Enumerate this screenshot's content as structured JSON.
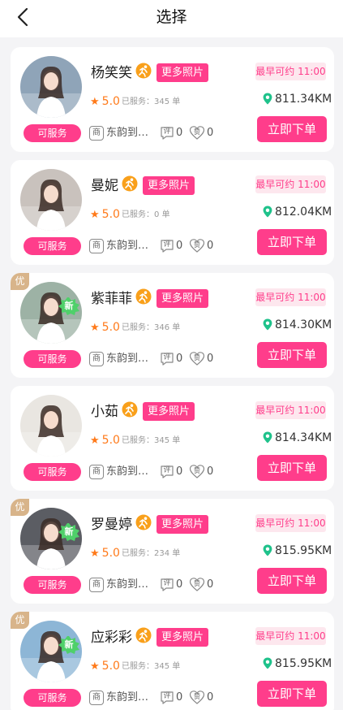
{
  "header": {
    "title": "选择"
  },
  "card_labels": {
    "more_photos": "更多照片",
    "served_prefix": "已服务：",
    "served_suffix": "单",
    "order_button": "立即下单",
    "shop_icon_char": "商",
    "review_icon_char": "评",
    "like_icon_char": "赞",
    "premium_tag": "优",
    "new_badge": "新"
  },
  "colors": {
    "accent": "#ff3d8b",
    "earliest_bg": "#fde7ee",
    "rating": "#ff7a1a",
    "badge_orange": "#f9a01b",
    "premium_tag_bg": "#d8b48a",
    "new_badge_green": "#4fd06a",
    "distance_pin": "#1fc28b",
    "page_bg": "#f4f4f6"
  },
  "icons": {
    "back": "chevron-left-icon",
    "run_badge": "running-person-badge-icon",
    "pin": "location-pin-icon",
    "star": "star-icon"
  },
  "providers": [
    {
      "name": "杨笑笑",
      "rating": "5.0",
      "served_count": "345",
      "status": "可服务",
      "shop": "东韵到…",
      "reviews": "0",
      "likes": "0",
      "earliest": "最早可约 11:00",
      "distance": "811.34KM",
      "premium": false,
      "is_new": false,
      "avatar_bg": "#8fa4b8"
    },
    {
      "name": "曼妮",
      "rating": "5.0",
      "served_count": "0",
      "status": "可服务",
      "shop": "东韵到…",
      "reviews": "0",
      "likes": "0",
      "earliest": "最早可约 11:00",
      "distance": "812.04KM",
      "premium": false,
      "is_new": false,
      "avatar_bg": "#c9c2bd"
    },
    {
      "name": "紫菲菲",
      "rating": "5.0",
      "served_count": "346",
      "status": "可服务",
      "shop": "东韵到…",
      "reviews": "0",
      "likes": "0",
      "earliest": "最早可约 11:00",
      "distance": "814.30KM",
      "premium": true,
      "is_new": true,
      "avatar_bg": "#9db2a5"
    },
    {
      "name": "小茹",
      "rating": "5.0",
      "served_count": "345",
      "status": "可服务",
      "shop": "东韵到…",
      "reviews": "0",
      "likes": "0",
      "earliest": "最早可约 11:00",
      "distance": "814.34KM",
      "premium": false,
      "is_new": false,
      "avatar_bg": "#e9e6e1"
    },
    {
      "name": "罗曼婷",
      "rating": "5.0",
      "served_count": "234",
      "status": "可服务",
      "shop": "东韵到…",
      "reviews": "0",
      "likes": "0",
      "earliest": "最早可约 11:00",
      "distance": "815.95KM",
      "premium": true,
      "is_new": true,
      "avatar_bg": "#5b5d63"
    },
    {
      "name": "应彩彩",
      "rating": "5.0",
      "served_count": "345",
      "status": "可服务",
      "shop": "东韵到…",
      "reviews": "0",
      "likes": "0",
      "earliest": "最早可约 11:00",
      "distance": "815.95KM",
      "premium": true,
      "is_new": true,
      "avatar_bg": "#8db6d6"
    }
  ]
}
